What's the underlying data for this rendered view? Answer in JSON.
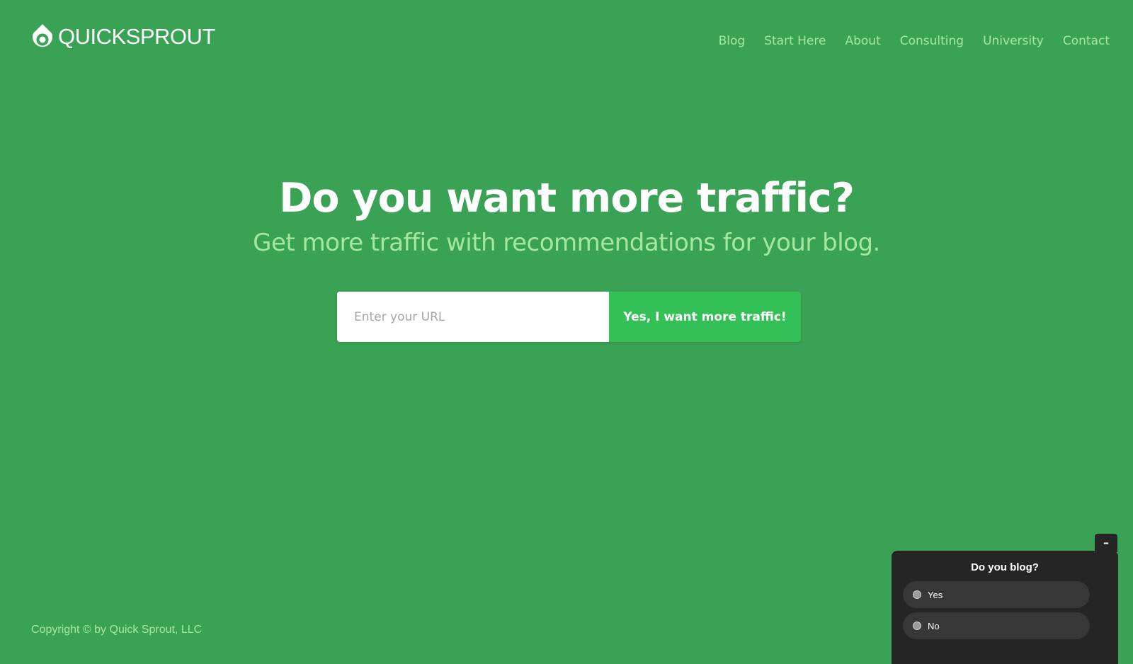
{
  "header": {
    "logo_text": "QUICKSPROUT",
    "nav": [
      {
        "label": "Blog"
      },
      {
        "label": "Start Here"
      },
      {
        "label": "About"
      },
      {
        "label": "Consulting"
      },
      {
        "label": "University"
      },
      {
        "label": "Contact"
      }
    ]
  },
  "hero": {
    "title": "Do you want more traffic?",
    "subtitle": "Get more traffic with recommendations for your blog.",
    "url_placeholder": "Enter your URL",
    "url_value": "",
    "cta_label": "Yes, I want more traffic!"
  },
  "footer": {
    "copyright": "Copyright © by Quick Sprout, LLC"
  },
  "survey": {
    "minimize_label": "–",
    "question": "Do you blog?",
    "options": [
      {
        "label": "Yes"
      },
      {
        "label": "No"
      }
    ]
  },
  "colors": {
    "background": "#3aa254",
    "accent_text": "#a4e8a0",
    "cta_button": "#33c157",
    "survey_bg": "#252525",
    "survey_option_bg": "#373737"
  },
  "icons": {
    "logo": "quicksprout-logo-icon",
    "radio": "radio-icon"
  }
}
